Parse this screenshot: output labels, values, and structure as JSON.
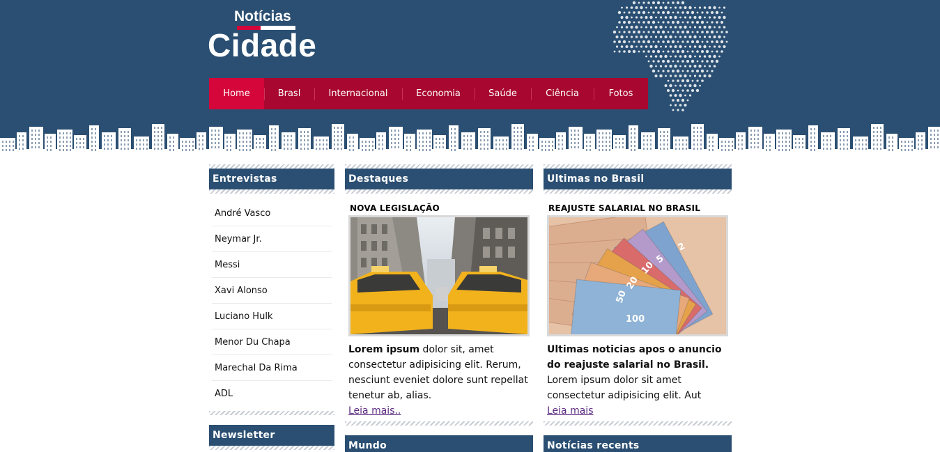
{
  "logo": {
    "top": "Notícias",
    "main": "Cidade"
  },
  "colors": {
    "header_bg": "#2b4f72",
    "nav_bg": "#a8072f",
    "nav_active": "#d4063a",
    "link": "#5b2a80"
  },
  "nav": {
    "items": [
      {
        "label": "Home",
        "active": true
      },
      {
        "label": "Brasl"
      },
      {
        "label": "Internacional"
      },
      {
        "label": "Economia"
      },
      {
        "label": "Saúde"
      },
      {
        "label": "Ciência"
      },
      {
        "label": "Fotos"
      }
    ]
  },
  "sidebar": {
    "interviews_title": "Entrevistas",
    "interviews": [
      "André Vasco",
      "Neymar Jr.",
      "Messi",
      "Xavi Alonso",
      "Luciano Hulk",
      "Menor Du Chapa",
      "Marechal Da Rima",
      "ADL"
    ],
    "newsletter_title": "Newsletter"
  },
  "destaques": {
    "title": "Destaques",
    "headline": "NOVA LEGISLAÇÃO",
    "lead_bold": "Lorem ipsum",
    "lead_rest": " dolor sit, amet consectetur adipisicing elit. Rerum, nesciunt eveniet dolore sunt repellat tenetur ab, alias.",
    "link": "Leia mais.."
  },
  "brasil": {
    "title": "Ultimas no Brasil",
    "headline": "REAJUSTE SALARIAL NO BRASIL",
    "lead_bold": "Ultimas noticias apos o anuncio do reajuste salarial no Brasil.",
    "lead_rest": " Lorem ipsum dolor sit amet consectetur adipisicing elit. Aut",
    "link": "Leia mais"
  },
  "bottom": {
    "mundo_title": "Mundo",
    "recent_title": "Notícias recents"
  },
  "banknotes": [
    "2",
    "5",
    "10",
    "20",
    "50",
    "100"
  ]
}
